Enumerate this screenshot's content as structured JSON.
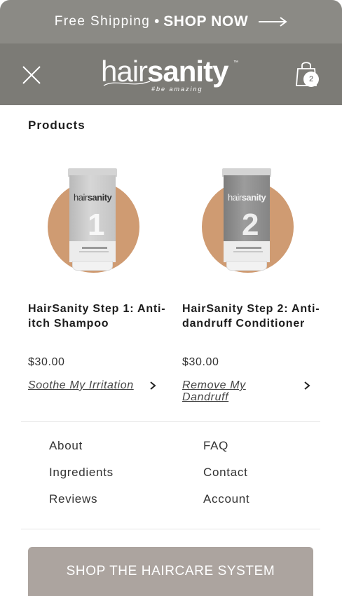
{
  "announcement": {
    "free_shipping": "Free Shipping",
    "separator": "•",
    "shop_now": "SHOP NOW",
    "arrow_icon": "long-arrow-right-icon"
  },
  "header": {
    "close_icon": "close-icon",
    "logo": {
      "part_light": "hair",
      "part_bold": "sanity",
      "trademark": "™",
      "tagline": "#be amazing"
    },
    "cart": {
      "icon": "shopping-bag-icon",
      "count": "2"
    }
  },
  "products_section": {
    "title": "Products",
    "items": [
      {
        "name": "HairSanity Step 1: Anti-itch Shampoo",
        "price": "$30.00",
        "link": "Soothe My Irritation",
        "tube_brand_light": "hair",
        "tube_brand_bold": "sanity",
        "tube_number": "1"
      },
      {
        "name": "HairSanity Step 2: Anti-dandruff Conditioner",
        "price": "$30.00",
        "link": "Remove My Dandruff",
        "tube_brand_light": "hair",
        "tube_brand_bold": "sanity",
        "tube_number": "2"
      }
    ]
  },
  "nav": {
    "left": [
      "About",
      "Ingredients",
      "Reviews"
    ],
    "right": [
      "FAQ",
      "Contact",
      "Account"
    ]
  },
  "cta": {
    "label": "SHOP THE HAIRCARE SYSTEM"
  },
  "colors": {
    "announcement_bg": "#8b8a85",
    "header_bg": "#7c7b76",
    "circle_accent": "#cf9b72",
    "cta_bg": "#aca49f"
  }
}
